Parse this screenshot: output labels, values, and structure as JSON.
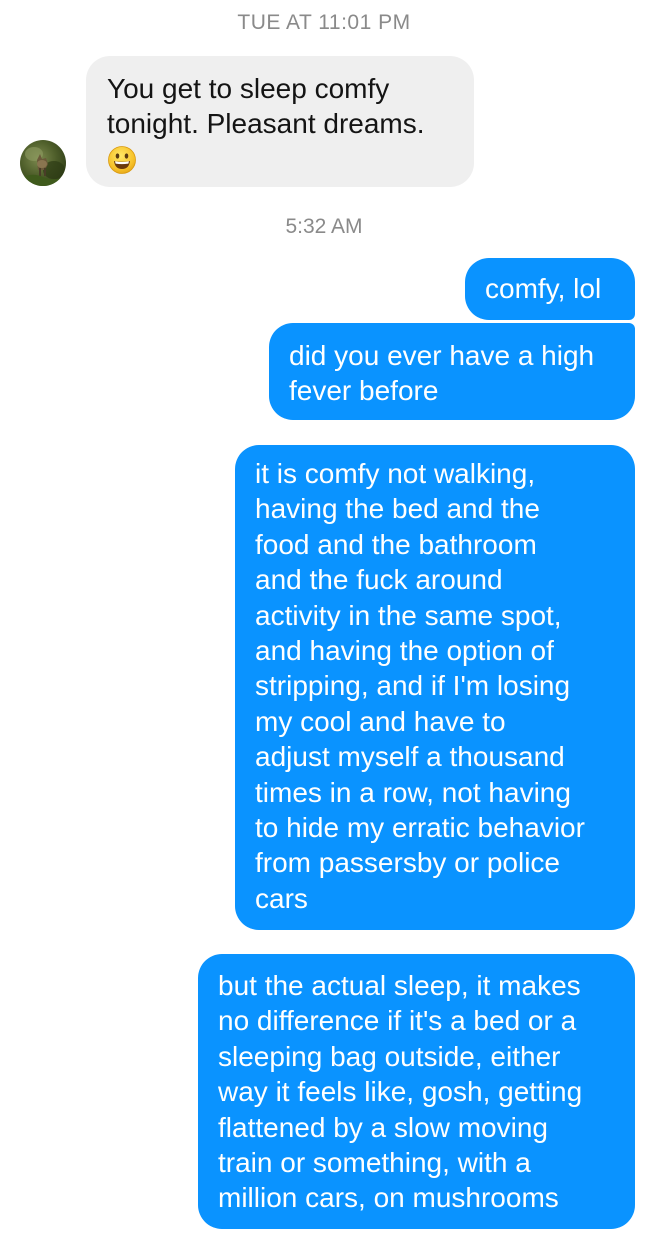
{
  "conversation": {
    "timestamp_1": "TUE AT 11:01 PM",
    "timestamp_2": "5:32 AM",
    "incoming": {
      "lines": [
        "You get to sleep comfy",
        "tonight. Pleasant dreams."
      ],
      "emoji": "grinning-face"
    },
    "outgoing": [
      {
        "lines": [
          "comfy, lol"
        ]
      },
      {
        "lines": [
          "did you ever have a high",
          "fever before"
        ]
      },
      {
        "lines": [
          "it is comfy not walking,",
          "having the bed and the",
          "food and the bathroom",
          "and the fuck around",
          "activity in the same spot,",
          "and having the option of",
          "stripping, and if I'm losing",
          "my cool and have to",
          "adjust myself a thousand",
          "times in a row, not having",
          "to hide my erratic behavior",
          "from passersby or police",
          "cars"
        ]
      },
      {
        "lines": [
          "but the actual sleep, it makes",
          "no difference if it's a bed or a",
          "sleeping bag outside, either",
          "way it feels like, gosh, getting",
          "flattened by a slow moving",
          "train or something, with a",
          "million cars, on mushrooms"
        ]
      }
    ]
  },
  "colors": {
    "outgoing_bubble": "#0a93ff",
    "incoming_bubble": "#efefef",
    "timestamp_text": "#8a8a8a"
  }
}
